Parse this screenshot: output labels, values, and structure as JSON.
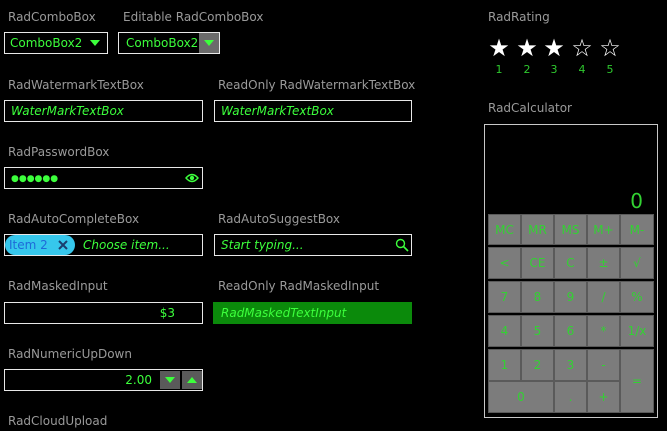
{
  "combo": {
    "label": "RadComboBox",
    "value": "ComboBox2",
    "editable_label": "Editable RadComboBox",
    "editable_value": "ComboBox2"
  },
  "watermark": {
    "label": "RadWatermarkTextBox",
    "value": "WaterMarkTextBox",
    "readonly_label": "ReadOnly RadWatermarkTextBox",
    "readonly_value": "WaterMarkTextBox"
  },
  "password": {
    "label": "RadPasswordBox",
    "value": "●●●●●●"
  },
  "autocomplete": {
    "label": "RadAutoCompleteBox",
    "token": "Item 2",
    "placeholder": "Choose item...",
    "suggest_label": "RadAutoSuggestBox",
    "suggest_placeholder": "Start typing..."
  },
  "masked": {
    "label": "RadMaskedInput",
    "value": "$3",
    "readonly_label": "ReadOnly RadMaskedInput",
    "readonly_value": "RadMaskedTextInput"
  },
  "numeric": {
    "label": "RadNumericUpDown",
    "value": "2.00"
  },
  "cloud": {
    "label": "RadCloudUpload"
  },
  "rating": {
    "label": "RadRating",
    "value": 3,
    "max": 5,
    "numbers": [
      "1",
      "2",
      "3",
      "4",
      "5"
    ]
  },
  "calculator": {
    "label": "RadCalculator",
    "display": "0",
    "keys": {
      "mc": "MC",
      "mr": "MR",
      "ms": "MS",
      "mplus": "M+",
      "mminus": "M-",
      "back": "<",
      "ce": "CE",
      "c": "C",
      "plusminus": "±",
      "sqrt": "√",
      "k7": "7",
      "k8": "8",
      "k9": "9",
      "div": "/",
      "pct": "%",
      "k4": "4",
      "k5": "5",
      "k6": "6",
      "mul": "*",
      "inv": "1/x",
      "k1": "1",
      "k2": "2",
      "k3": "3",
      "sub": "-",
      "eq": "=",
      "k0": "0",
      "dot": ".",
      "add": "+"
    }
  },
  "colors": {
    "accent": "#2ee62e",
    "readonly_bg": "#0b8a0b",
    "token_bg": "#36c7ec",
    "key_bg": "#7c7c7c"
  }
}
